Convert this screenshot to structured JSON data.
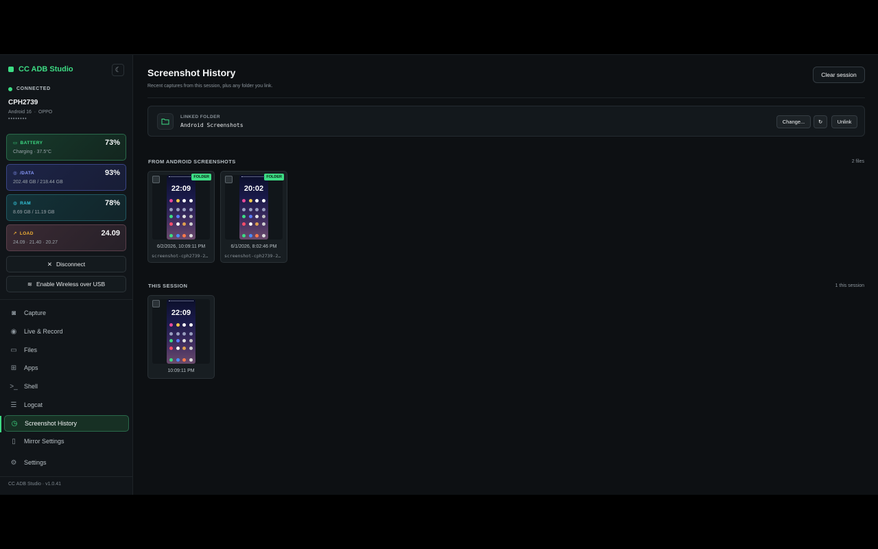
{
  "sidebar": {
    "brand": "CC ADB Studio",
    "connection": "CONNECTED",
    "device": {
      "name": "CPH2739",
      "os": "Android 16",
      "maker": "OPPO",
      "serial": "••••••••"
    },
    "stats": {
      "battery": {
        "label": "BATTERY",
        "value": "73%",
        "sub": "Charging · 37.5°C",
        "level_pct": 73
      },
      "data": {
        "label": "/DATA",
        "value": "93%",
        "sub": "202.48 GB / 218.44 GB",
        "level_pct": 93
      },
      "ram": {
        "label": "RAM",
        "value": "78%",
        "sub": "8.69 GB / 11.19 GB",
        "level_pct": 78
      },
      "load": {
        "label": "LOAD",
        "value": "24.09",
        "sub": "24.09 · 21.40 · 20.27"
      }
    },
    "buttons": {
      "disconnect": "Disconnect",
      "wireless": "Enable Wireless over USB"
    },
    "nav": [
      "Capture",
      "Live & Record",
      "Files",
      "Apps",
      "Shell",
      "Logcat",
      "Screenshot History",
      "Mirror Settings",
      "Settings"
    ],
    "active_nav": "Screenshot History",
    "version": "CC ADB Studio · v1.0.41"
  },
  "main": {
    "title": "Screenshot History",
    "subtitle": "Recent captures from this session, plus any folder you link.",
    "clear_button": "Clear session",
    "linked": {
      "label": "LINKED FOLDER",
      "path": "Android Screenshots",
      "change": "Change...",
      "refresh_icon": "↻",
      "unlink": "Unlink"
    },
    "folder_section": {
      "title": "FROM ANDROID SCREENSHOTS",
      "count": "2 files",
      "items": [
        {
          "badge": "FOLDER",
          "phone_time": "22:09",
          "date": "6/2/2026, 10:09:11 PM",
          "file": "screenshot-cph2739-2..."
        },
        {
          "badge": "FOLDER",
          "phone_time": "20:02",
          "date": "6/1/2026, 8:02:46 PM",
          "file": "screenshot-cph2739-2..."
        }
      ]
    },
    "session_section": {
      "title": "THIS SESSION",
      "count": "1 this session",
      "items": [
        {
          "phone_time": "22:09",
          "time": "10:09:11 PM"
        }
      ]
    }
  },
  "colors": {
    "accent": "#3ddc84",
    "bg": "#0d1013",
    "sidebar": "#111519"
  }
}
